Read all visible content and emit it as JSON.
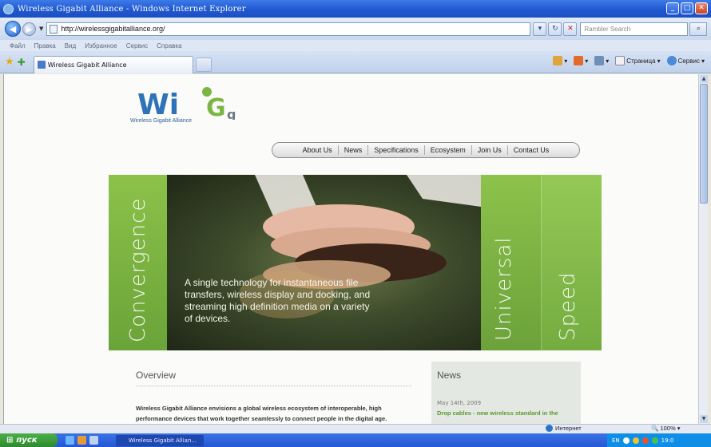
{
  "window": {
    "title": "Wireless Gigabit Alliance - Windows Internet Explorer",
    "min": "_",
    "max": "□",
    "close": "✕"
  },
  "address": {
    "url": "http://wirelessgigabitalliance.org/",
    "search_placeholder": "Rambler Search"
  },
  "menu": [
    "Файл",
    "Правка",
    "Вид",
    "Избранное",
    "Сервис",
    "Справка"
  ],
  "tab": {
    "label": "Wireless Gigabit Alliance"
  },
  "commands": {
    "page": "Страница",
    "tools": "Сервис"
  },
  "site": {
    "logo_text": "WiG",
    "logo_tagline": "Wireless Gigabit Alliance",
    "nav": [
      "About Us",
      "News",
      "Specifications",
      "Ecosystem",
      "Join Us",
      "Contact Us"
    ],
    "hero": {
      "left_word": "Convergence",
      "right_word_1": "Universal",
      "right_word_2": "Speed",
      "caption": "A single technology for instantaneous file transfers, wireless display and docking, and streaming high definition media on a variety of devices."
    },
    "overview": {
      "title": "Overview",
      "text": "Wireless Gigabit Alliance envisions a global wireless ecosystem of interoperable, high performance devices that work together seamlessly to connect people in the digital age."
    },
    "news": {
      "title": "News",
      "date": "May 14th, 2009",
      "headline": "Drop cables - new wireless standard in the"
    }
  },
  "status": {
    "zone": "Интернет",
    "zoom": "100%"
  },
  "taskbar": {
    "start": "пуск",
    "item": "Wireless Gigabit Allian...",
    "lang": "EN",
    "time": "19:0"
  },
  "colors": {
    "accent_green": "#7bb543",
    "titlebar_blue": "#1f56cf",
    "logo_blue": "#2e73b8"
  }
}
